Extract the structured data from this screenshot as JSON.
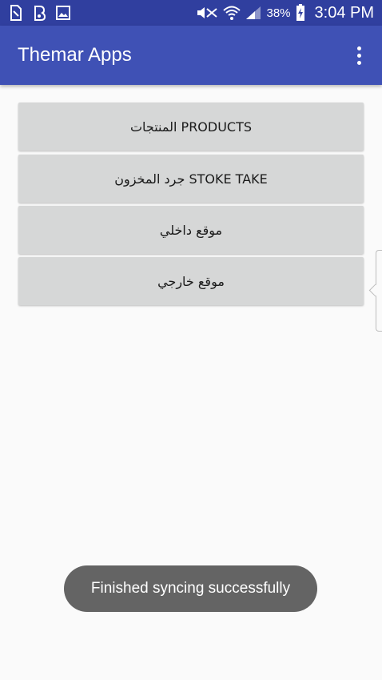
{
  "status_bar": {
    "battery_percent": "38%",
    "time": "3:04 PM",
    "icons": [
      "sim-icon",
      "data-saver-icon",
      "image-icon",
      "mute-icon",
      "wifi-icon",
      "signal-icon",
      "battery-charging-icon"
    ]
  },
  "app_bar": {
    "title": "Themar Apps",
    "menu_icon": "more-vert-icon"
  },
  "buttons": [
    {
      "label": "المنتجات PRODUCTS"
    },
    {
      "label": "جرد المخزون STOKE TAKE"
    },
    {
      "label": "موقع داخلي"
    },
    {
      "label": "موقع خارجي"
    }
  ],
  "toast": {
    "message": "Finished syncing successfully"
  },
  "colors": {
    "status_bar": "#303f9f",
    "app_bar": "#3f51b5",
    "button": "#d6d7d7",
    "toast": "#646464",
    "background": "#fafafa"
  }
}
